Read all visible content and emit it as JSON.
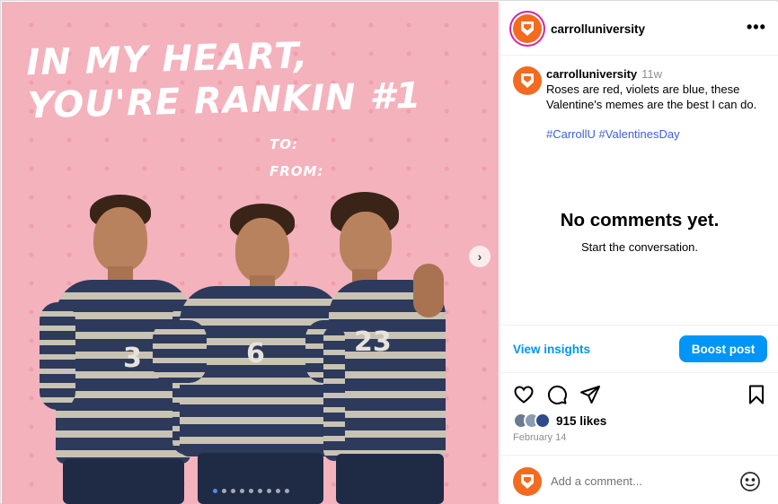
{
  "media": {
    "headline": "In my heart,\nyou're Rankin #1",
    "to_label": "To:",
    "from_label": "From:",
    "jersey_numbers": [
      "3",
      "6",
      "23"
    ],
    "slide_count": 9,
    "active_slide": 1,
    "background_color": "#f4b2bd"
  },
  "header": {
    "username": "carrolluniversity",
    "more_icon": "more-horizontal-icon"
  },
  "caption": {
    "username": "carrolluniversity",
    "time": "11w",
    "text": "Roses are red, violets are blue, these Valentine's memes are the best I can do.",
    "hashtags": [
      "#CarrollU",
      "#ValentinesDay"
    ]
  },
  "comments": {
    "empty_title": "No comments yet.",
    "empty_subtitle": "Start the conversation."
  },
  "insights": {
    "link_label": "View insights",
    "boost_label": "Boost post"
  },
  "engagement": {
    "likes": "915 likes",
    "date": "February 14"
  },
  "comment_box": {
    "placeholder": "Add a comment..."
  },
  "colors": {
    "brand_orange": "#f26b21",
    "link_blue": "#0095f6",
    "hashtag_blue": "#3d5ee1"
  }
}
